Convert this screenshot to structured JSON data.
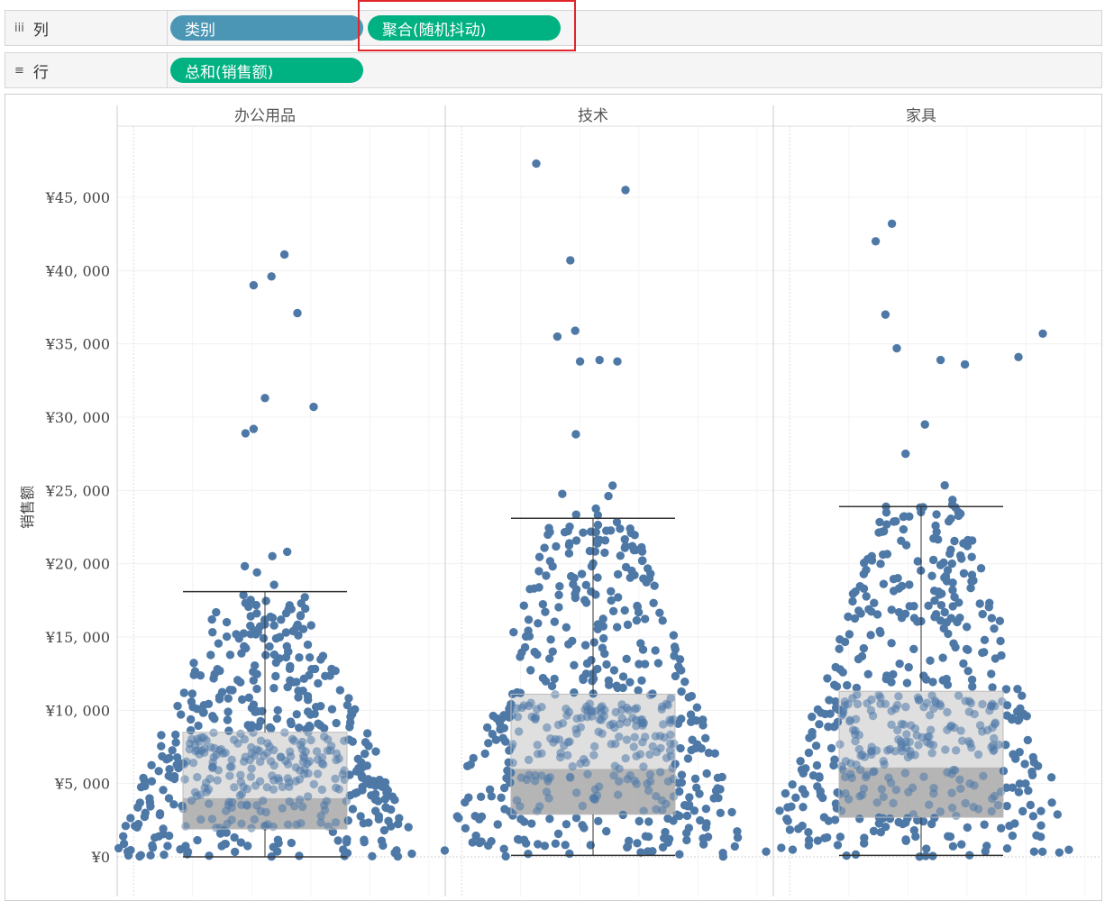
{
  "shelves": {
    "columns": {
      "label": "列",
      "icon": "columns-icon",
      "pills": [
        "类别",
        "聚合(随机抖动)"
      ]
    },
    "rows": {
      "label": "行",
      "icon": "rows-icon",
      "pills": [
        "总和(销售额)"
      ]
    }
  },
  "colors": {
    "point": "#4e79a7",
    "pill_dimension": "#4a96b4",
    "pill_measure": "#00b182",
    "highlight": "#e0252b"
  },
  "chart_data": {
    "type": "scatter",
    "ylabel": "销售额",
    "ylim": [
      0,
      48500
    ],
    "y_ticks": [
      0,
      5000,
      10000,
      15000,
      20000,
      25000,
      30000,
      35000,
      40000,
      45000
    ],
    "y_tick_labels": [
      "¥0",
      "¥5, 000",
      "¥10, 000",
      "¥15, 000",
      "¥20, 000",
      "¥25, 000",
      "¥30, 000",
      "¥35, 000",
      "¥40, 000",
      "¥45, 000"
    ],
    "grid": true,
    "categories": [
      "办公用品",
      "技术",
      "家具"
    ],
    "box_plots": [
      {
        "category": "办公用品",
        "whisker_low": 0,
        "q1": 1900,
        "median": 4000,
        "q3": 8500,
        "whisker_high": 18100
      },
      {
        "category": "技术",
        "whisker_low": 100,
        "q1": 2900,
        "median": 6000,
        "q3": 11100,
        "whisker_high": 23100
      },
      {
        "category": "家具",
        "whisker_low": 100,
        "q1": 2700,
        "median": 6100,
        "q3": 11300,
        "whisker_high": 23900
      }
    ],
    "outliers": [
      {
        "category": "办公用品",
        "jitter": 0.12,
        "y": 41100
      },
      {
        "category": "办公用品",
        "jitter": 0.04,
        "y": 39600
      },
      {
        "category": "办公用品",
        "jitter": -0.07,
        "y": 39000
      },
      {
        "category": "办公用品",
        "jitter": 0.2,
        "y": 37100
      },
      {
        "category": "办公用品",
        "jitter": 0.0,
        "y": 31300
      },
      {
        "category": "办公用品",
        "jitter": 0.3,
        "y": 30700
      },
      {
        "category": "办公用品",
        "jitter": -0.12,
        "y": 28900
      },
      {
        "category": "办公用品",
        "jitter": -0.07,
        "y": 29200
      },
      {
        "category": "技术",
        "jitter": -0.35,
        "y": 47300
      },
      {
        "category": "技术",
        "jitter": 0.2,
        "y": 45500
      },
      {
        "category": "技术",
        "jitter": -0.14,
        "y": 40700
      },
      {
        "category": "技术",
        "jitter": -0.11,
        "y": 35900
      },
      {
        "category": "技术",
        "jitter": -0.22,
        "y": 35500
      },
      {
        "category": "技术",
        "jitter": -0.08,
        "y": 33800
      },
      {
        "category": "技术",
        "jitter": 0.04,
        "y": 33900
      },
      {
        "category": "技术",
        "jitter": 0.15,
        "y": 33800
      },
      {
        "category": "家具",
        "jitter": -0.28,
        "y": 42000
      },
      {
        "category": "家具",
        "jitter": -0.18,
        "y": 43200
      },
      {
        "category": "家具",
        "jitter": -0.22,
        "y": 37000
      },
      {
        "category": "家具",
        "jitter": 0.75,
        "y": 35700
      },
      {
        "category": "家具",
        "jitter": 0.6,
        "y": 34100
      },
      {
        "category": "家具",
        "jitter": 0.12,
        "y": 33900
      },
      {
        "category": "家具",
        "jitter": 0.27,
        "y": 33600
      },
      {
        "category": "家具",
        "jitter": -0.15,
        "y": 34700
      }
    ],
    "dense_points_per_category": 520
  }
}
